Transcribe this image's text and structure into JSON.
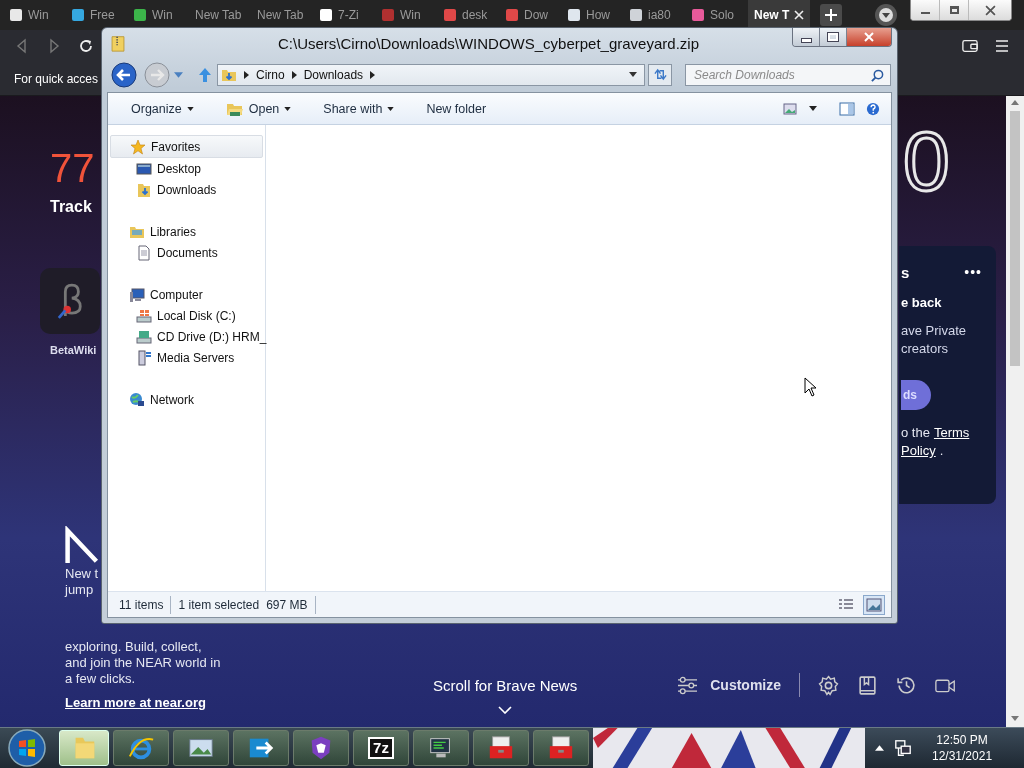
{
  "browser": {
    "tabs": [
      {
        "label": "Win",
        "selected": false
      },
      {
        "label": "Free",
        "selected": false
      },
      {
        "label": "Win",
        "selected": false
      },
      {
        "label": "New Tab",
        "selected": false
      },
      {
        "label": "New Tab",
        "selected": false
      },
      {
        "label": "7-Zi",
        "selected": false
      },
      {
        "label": "Win",
        "selected": false
      },
      {
        "label": "desk",
        "selected": false
      },
      {
        "label": "Dow",
        "selected": false
      },
      {
        "label": "How",
        "selected": false
      },
      {
        "label": "ia80",
        "selected": false
      },
      {
        "label": "Solo",
        "selected": false
      },
      {
        "label": "New T",
        "selected": true
      }
    ],
    "quick_access_text": "For quick acces"
  },
  "new_tab_page": {
    "stat": {
      "value": "77",
      "label": "Track"
    },
    "top_site": {
      "label": "BetaWiki"
    },
    "right_counter": "0",
    "rewards_card": {
      "heading": "s",
      "more": "•••",
      "title": "e back",
      "body": "ave Private",
      "body_2": "creators",
      "button": "ds",
      "terms_prefix": "o the",
      "terms_link": "Terms",
      "policy_link": "Policy",
      "policy_suffix": "."
    },
    "near": {
      "line_1": "New t",
      "line_2": "jump",
      "text": "exploring. Build, collect, and join the NEAR world in a few clicks.",
      "link": "Learn more at near.org"
    },
    "news_prompt": "Scroll for Brave News",
    "customize": "Customize"
  },
  "explorer": {
    "title": "C:\\Users\\Cirno\\Downloads\\WINDOWS_cyberpet_graveyard.zip",
    "breadcrumbs": [
      "Cirno",
      "Downloads"
    ],
    "search": {
      "placeholder": "Search Downloads"
    },
    "commands": [
      {
        "label": "Open",
        "menu": true,
        "kind": "open"
      },
      {
        "label": "Share with",
        "menu": true,
        "kind": "plain"
      },
      {
        "label": "New folder",
        "menu": false,
        "kind": "plain"
      }
    ],
    "organize": "Organize",
    "nav": [
      {
        "label": "Favorites",
        "selected": true,
        "children": [
          {
            "label": "Desktop",
            "selected": false
          },
          {
            "label": "Downloads",
            "selected": false
          }
        ]
      },
      {
        "label": "Libraries",
        "selected": false,
        "children": [
          {
            "label": "Documents",
            "selected": false
          }
        ]
      },
      {
        "label": "Computer",
        "selected": false,
        "children": [
          {
            "label": "Local Disk (C:)",
            "selected": false
          },
          {
            "label": "CD Drive (D:) HRM_",
            "selected": false
          },
          {
            "label": "Media Servers",
            "selected": false
          }
        ]
      },
      {
        "label": "Network",
        "selected": false
      }
    ],
    "status": {
      "items": "11 items",
      "selection": "1 item selected",
      "size": "697 MB"
    }
  },
  "taskbar": {
    "buttons": [
      {
        "selected": true
      },
      {
        "selected": false
      },
      {
        "selected": false
      },
      {
        "selected": false
      },
      {
        "selected": false
      },
      {
        "selected": false,
        "label": "7z"
      },
      {
        "selected": false
      },
      {
        "selected": false
      },
      {
        "selected": false
      }
    ],
    "clock": {
      "time": "12:50 PM",
      "date": "12/31/2021"
    }
  }
}
